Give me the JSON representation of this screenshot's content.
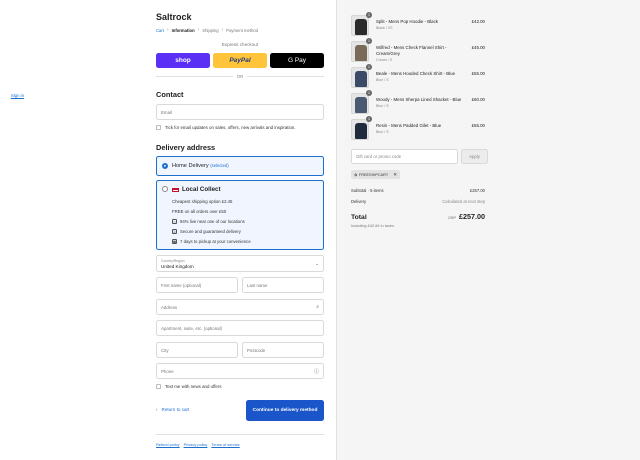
{
  "store": {
    "name": "Saltrock"
  },
  "breadcrumb": {
    "cart": "Cart",
    "information": "Information",
    "shipping": "Shipping",
    "payment": "Payment method"
  },
  "express": {
    "title": "Express checkout",
    "shop": "shop",
    "paypal": "PayPal",
    "gpay": "G Pay",
    "or": "OR"
  },
  "contact": {
    "heading": "Contact",
    "signin": "Sign in",
    "email_placeholder": "Email",
    "newsletter_label": "Tick for email updates on sales, offers, new arrivals and inspiration."
  },
  "delivery": {
    "heading": "Delivery address",
    "home": {
      "label": "Home Delivery",
      "selected": "(selected)"
    },
    "local": {
      "label": "Local Collect",
      "lines": [
        "Cheapest shipping option £2.45",
        "FREE on all orders over £50",
        "94% live near one of our locations",
        "Secure and guaranteed delivery",
        "7 days to pickup at your convenience"
      ]
    },
    "country_label": "Country/Region",
    "country_value": "United Kingdom",
    "first_name": "First name (optional)",
    "last_name": "Last name",
    "address": "Address",
    "apartment": "Apartment, suite, etc. (optional)",
    "city": "City",
    "postcode": "Postcode",
    "phone": "Phone",
    "text_me": "Text me with news and offers"
  },
  "nav": {
    "back": "Return to cart",
    "continue": "Continue to delivery method"
  },
  "footer": {
    "links": [
      "Refund policy",
      "Privacy policy",
      "Terms of service"
    ]
  },
  "cart": {
    "items": [
      {
        "name": "Split - Mens Pop Hoodie - Black",
        "variant": "Black / XS",
        "price": "£42.00",
        "qty": "1",
        "color": "#2a2a2a"
      },
      {
        "name": "Wilfred - Mens Check Flannel Shirt - Cream/Grey",
        "variant": "Cream / S",
        "price": "£45.00",
        "qty": "1",
        "color": "#7a6a58"
      },
      {
        "name": "Beale - Mens Hooded Check Shirt - Blue",
        "variant": "Blue / S",
        "price": "£55.00",
        "qty": "1",
        "color": "#3b4a66"
      },
      {
        "name": "Woody - Mens Sherpa Lined Shacket - Blue",
        "variant": "Blue / S",
        "price": "£60.00",
        "qty": "1",
        "color": "#4a5872"
      },
      {
        "name": "Resin - Mens Padded Gilet - Blue",
        "variant": "Blue / S",
        "price": "£55.00",
        "qty": "1",
        "color": "#1f2a3d"
      }
    ],
    "promo_placeholder": "Gift card or promo code",
    "apply": "Apply",
    "discount_code": "FREESHIPCART",
    "subtotal_label": "Subtotal · 5 items",
    "subtotal_value": "£257.00",
    "delivery_label": "Delivery",
    "delivery_value": "Calculated at next step",
    "total_label": "Total",
    "currency": "GBP",
    "total_value": "£257.00",
    "tax_note": "Including £42.84 in taxes"
  },
  "colors": {
    "accent": "#1a56c9",
    "shop": "#5a31f4",
    "paypal": "#ffc439",
    "panel": "#f5f5f5"
  }
}
